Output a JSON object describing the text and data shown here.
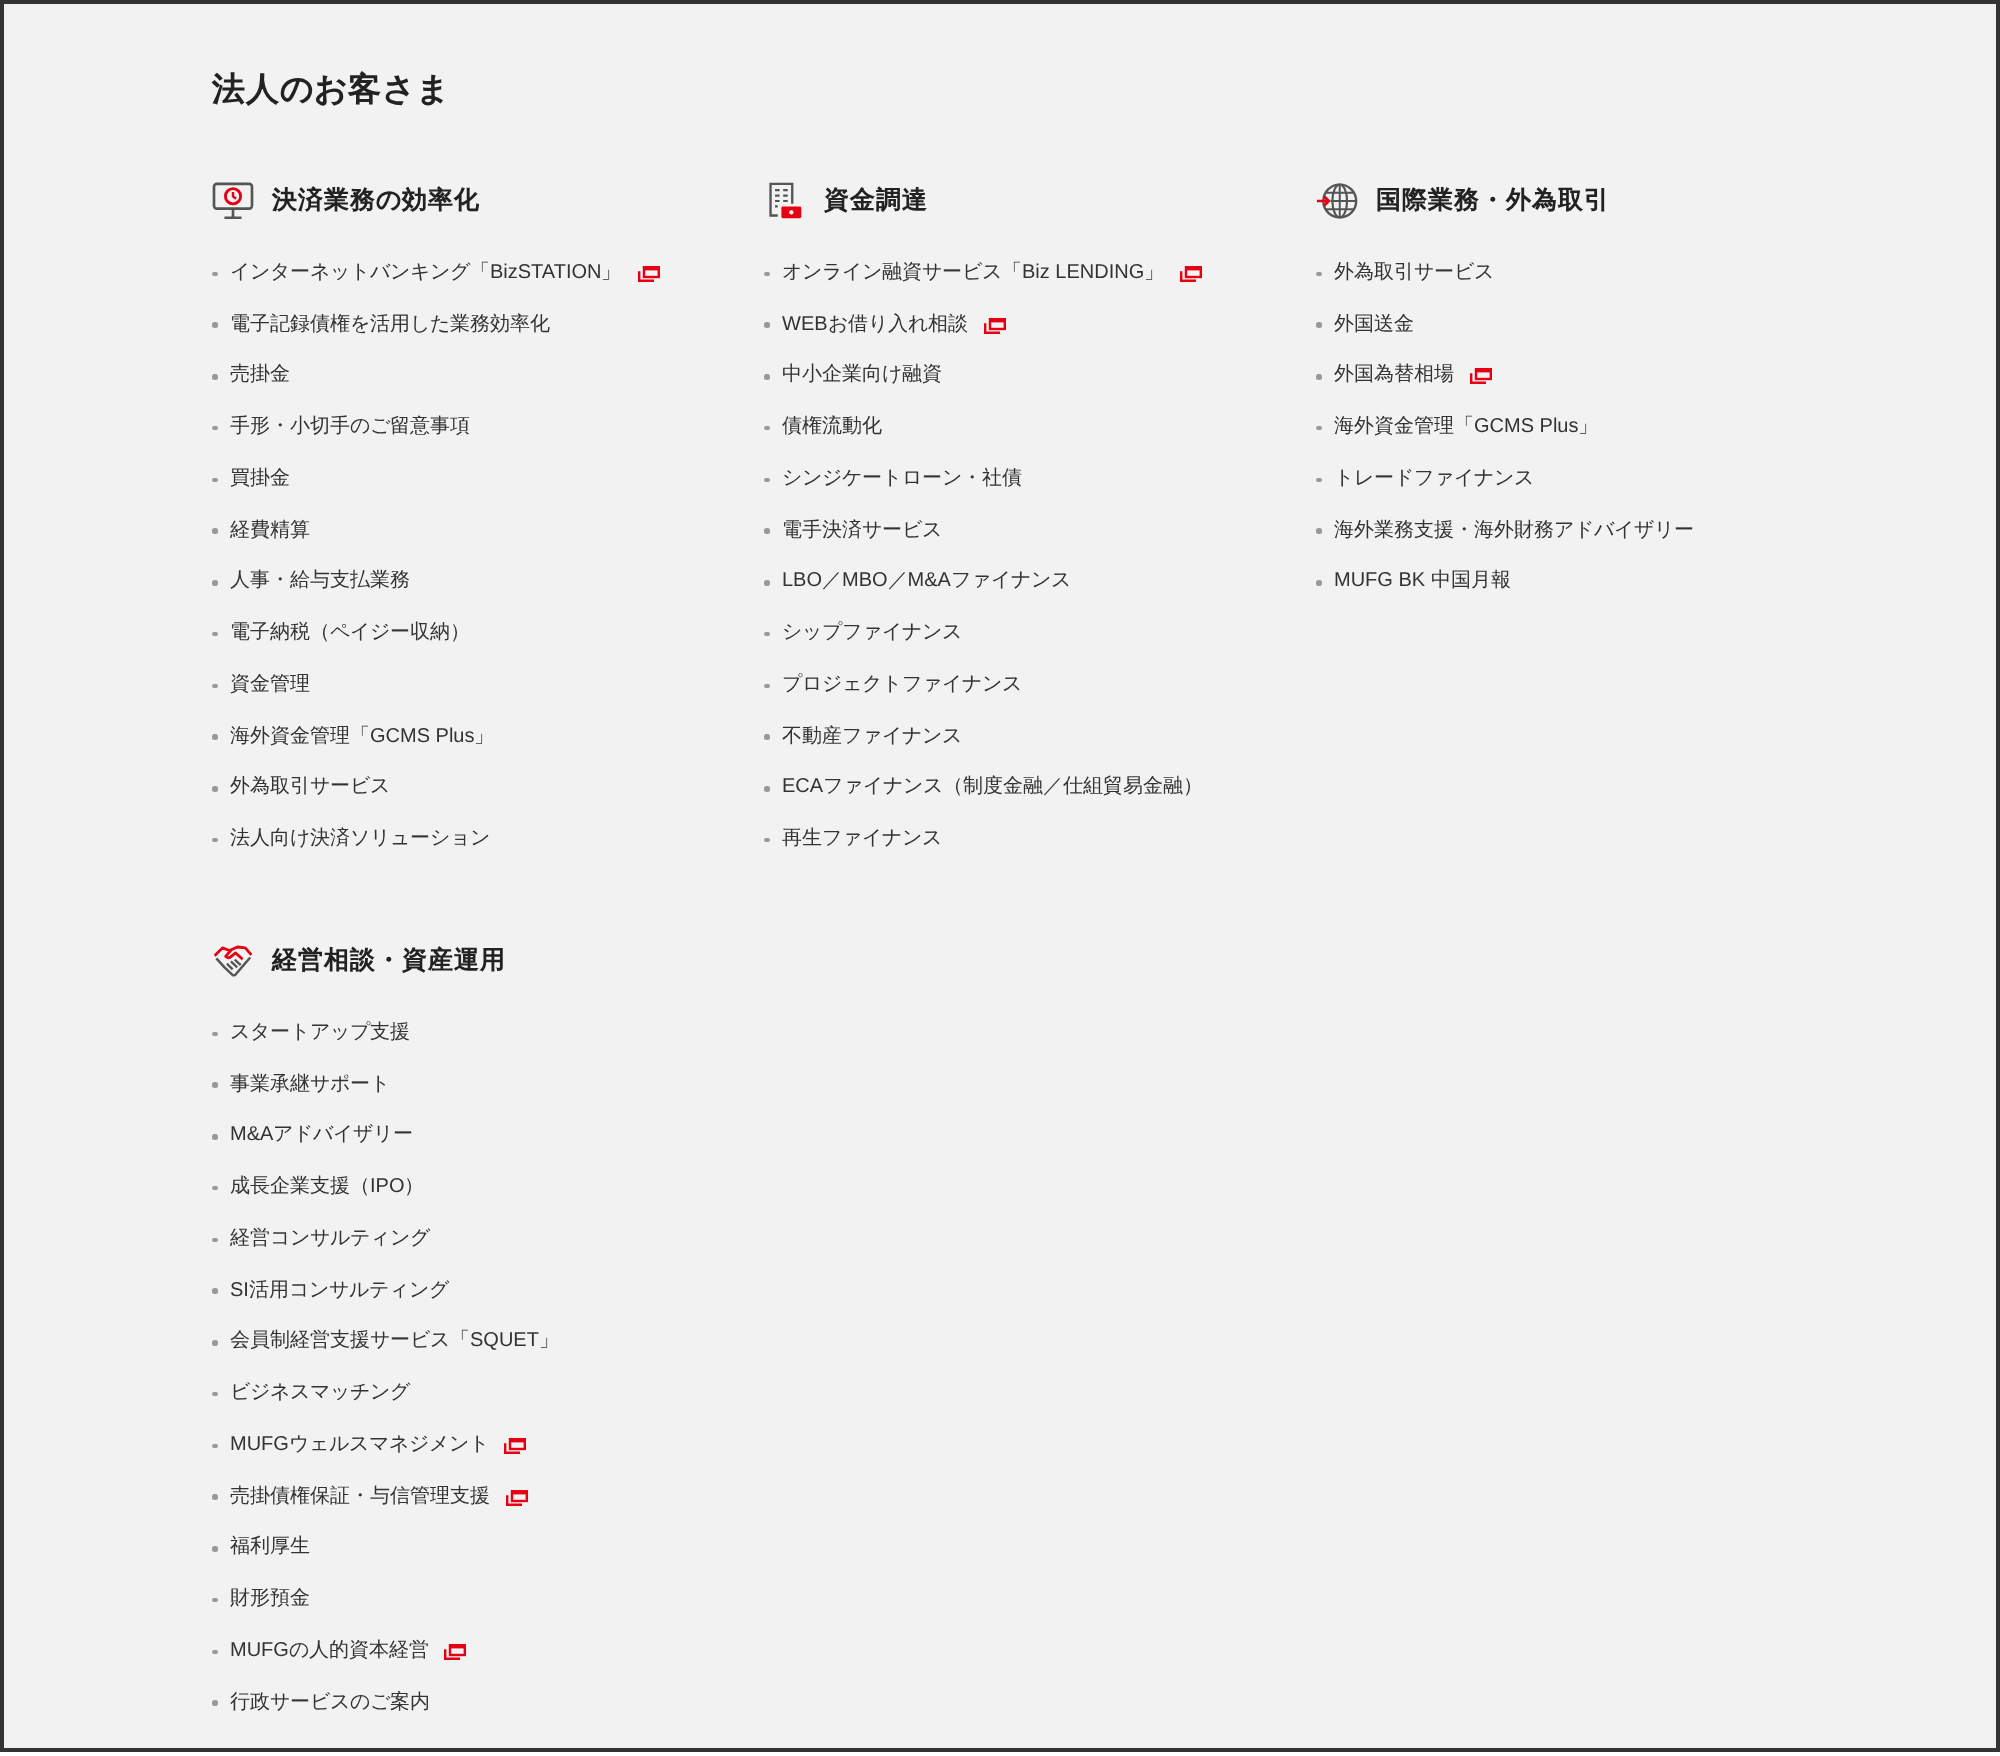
{
  "title": "法人のお客さま",
  "sections": [
    {
      "heading": "決済業務の効率化",
      "items": [
        {
          "label": "インターネットバンキング「BizSTATION」",
          "external": true
        },
        {
          "label": "電子記録債権を活用した業務効率化",
          "external": false
        },
        {
          "label": "売掛金",
          "external": false
        },
        {
          "label": "手形・小切手のご留意事項",
          "external": false
        },
        {
          "label": "買掛金",
          "external": false
        },
        {
          "label": "経費精算",
          "external": false
        },
        {
          "label": "人事・給与支払業務",
          "external": false
        },
        {
          "label": "電子納税（ペイジー収納）",
          "external": false
        },
        {
          "label": "資金管理",
          "external": false
        },
        {
          "label": "海外資金管理「GCMS Plus」",
          "external": false
        },
        {
          "label": "外為取引サービス",
          "external": false
        },
        {
          "label": "法人向け決済ソリューション",
          "external": false
        }
      ]
    },
    {
      "heading": "資金調達",
      "items": [
        {
          "label": "オンライン融資サービス「Biz LENDING」",
          "external": true
        },
        {
          "label": "WEBお借り入れ相談",
          "external": true
        },
        {
          "label": "中小企業向け融資",
          "external": false
        },
        {
          "label": "債権流動化",
          "external": false
        },
        {
          "label": "シンジケートローン・社債",
          "external": false
        },
        {
          "label": "電手決済サービス",
          "external": false
        },
        {
          "label": "LBO／MBO／M&Aファイナンス",
          "external": false
        },
        {
          "label": "シップファイナンス",
          "external": false
        },
        {
          "label": "プロジェクトファイナンス",
          "external": false
        },
        {
          "label": "不動産ファイナンス",
          "external": false
        },
        {
          "label": "ECAファイナンス（制度金融／仕組貿易金融）",
          "external": false
        },
        {
          "label": "再生ファイナンス",
          "external": false
        }
      ]
    },
    {
      "heading": "国際業務・外為取引",
      "items": [
        {
          "label": "外為取引サービス",
          "external": false
        },
        {
          "label": "外国送金",
          "external": false
        },
        {
          "label": "外国為替相場",
          "external": true
        },
        {
          "label": "海外資金管理「GCMS Plus」",
          "external": false
        },
        {
          "label": "トレードファイナンス",
          "external": false
        },
        {
          "label": "海外業務支援・海外財務アドバイザリー",
          "external": false
        },
        {
          "label": "MUFG BK 中国月報",
          "external": false
        }
      ]
    },
    {
      "heading": "経営相談・資産運用",
      "items": [
        {
          "label": "スタートアップ支援",
          "external": false
        },
        {
          "label": "事業承継サポート",
          "external": false
        },
        {
          "label": "M&Aアドバイザリー",
          "external": false
        },
        {
          "label": "成長企業支援（IPO）",
          "external": false
        },
        {
          "label": "経営コンサルティング",
          "external": false
        },
        {
          "label": "SI活用コンサルティング",
          "external": false
        },
        {
          "label": "会員制経営支援サービス「SQUET」",
          "external": false
        },
        {
          "label": "ビジネスマッチング",
          "external": false
        },
        {
          "label": "MUFGウェルスマネジメント",
          "external": true
        },
        {
          "label": "売掛債権保証・与信管理支援",
          "external": true
        },
        {
          "label": "福利厚生",
          "external": false
        },
        {
          "label": "財形預金",
          "external": false
        },
        {
          "label": "MUFGの人的資本経営",
          "external": true
        },
        {
          "label": "行政サービスのご案内",
          "external": false
        }
      ]
    }
  ]
}
